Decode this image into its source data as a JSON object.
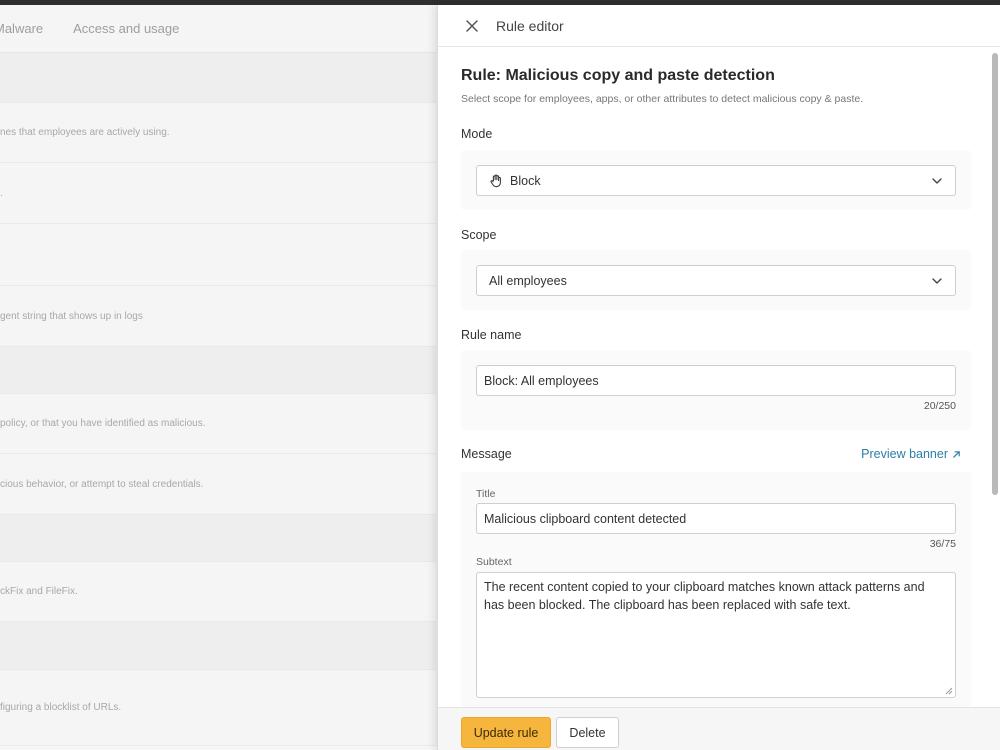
{
  "background": {
    "tabs": [
      "Malware",
      "Access and usage"
    ],
    "rows": [
      "",
      "nes that employees are actively using.",
      ".",
      "",
      "gent string that shows up in logs",
      "",
      "policy, or that you have identified as malicious.",
      "cious behavior, or attempt to steal credentials.",
      "",
      "ckFix and FileFix.",
      "",
      "figuring a blocklist of URLs."
    ]
  },
  "panel": {
    "header_title": "Rule editor",
    "rule_title": "Rule: Malicious copy and paste detection",
    "rule_description": "Select scope for employees, apps, or other attributes to detect malicious copy & paste.",
    "mode": {
      "label": "Mode",
      "value": "Block",
      "icon": "hand-stop-icon"
    },
    "scope": {
      "label": "Scope",
      "value": "All employees"
    },
    "rule_name": {
      "label": "Rule name",
      "value": "Block: All employees",
      "counter": "20/250"
    },
    "message": {
      "label": "Message",
      "preview_link": "Preview banner",
      "title_label": "Title",
      "title_value": "Malicious clipboard content detected",
      "title_counter": "36/75",
      "subtext_label": "Subtext",
      "subtext_value": "The recent content copied to your clipboard matches known attack patterns and has been blocked. The clipboard has been replaced with safe text."
    },
    "footer": {
      "update_label": "Update rule",
      "delete_label": "Delete"
    }
  },
  "colors": {
    "accent": "#f6b63e",
    "link": "#2d7ea6"
  }
}
